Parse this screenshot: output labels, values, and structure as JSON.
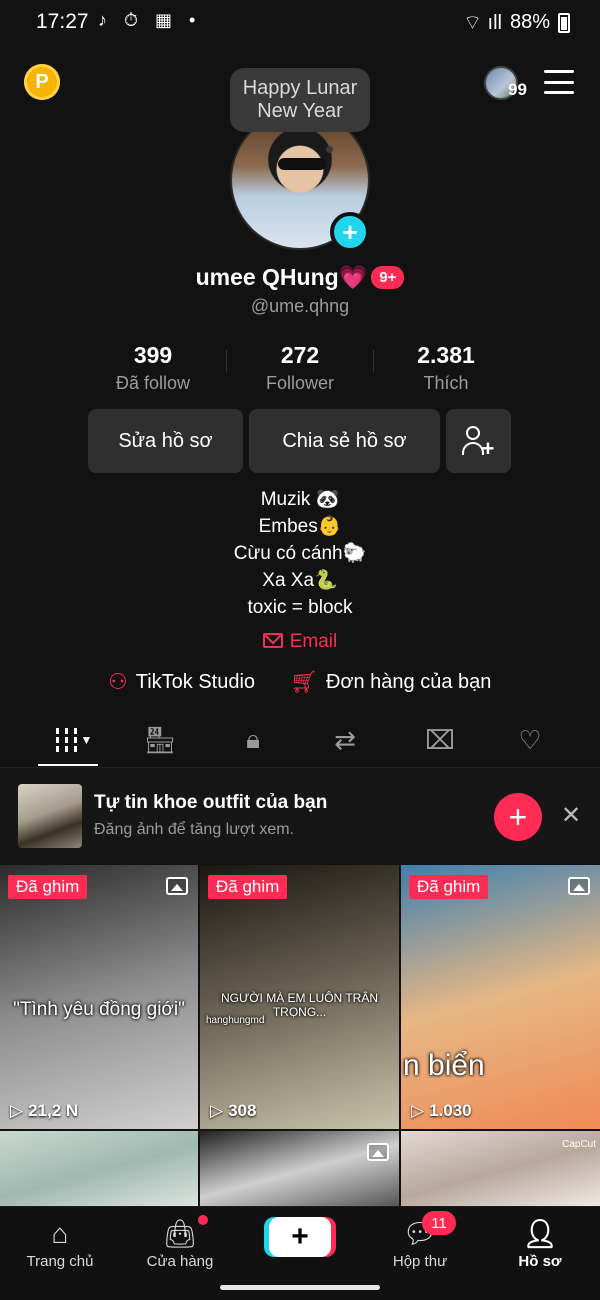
{
  "status_bar": {
    "time": "17:27",
    "left_icons": "♪ ⏱ ▦ •",
    "signal": "⌔ ıll",
    "battery": "88%"
  },
  "header": {
    "story_count": "99"
  },
  "profile": {
    "note": "Happy Lunar New Year",
    "display_name": "umee QHung",
    "display_name_emoji": "💗",
    "badge": "9+",
    "username": "@ume.qhng",
    "stats": [
      {
        "value": "399",
        "label": "Đã follow"
      },
      {
        "value": "272",
        "label": "Follower"
      },
      {
        "value": "2.381",
        "label": "Thích"
      }
    ],
    "buttons": {
      "edit": "Sửa hồ sơ",
      "share": "Chia sẻ hồ sơ"
    },
    "bio": [
      "Muzik 🐼",
      "Embes👶",
      "Cừu có cánh🐑",
      "Xa Xa🐍",
      "toxic = block"
    ],
    "email_label": "Email",
    "links": {
      "studio": "TikTok Studio",
      "orders": "Đơn hàng của bạn"
    }
  },
  "tabs": [
    "videos",
    "shop",
    "private",
    "reposts",
    "favorites-hidden",
    "liked"
  ],
  "promo": {
    "title": "Tự tin khoe outfit của bạn",
    "subtitle": "Đăng ảnh để tăng lượt xem."
  },
  "videos": [
    {
      "pinned": "Đã ghim",
      "views": "21,2 N",
      "overlay": "\"Tình yêu đồng giới\"",
      "colors": [
        "#2b2b2b",
        "#8d8d8d",
        "#d0d0d0"
      ]
    },
    {
      "pinned": "Đã ghim",
      "views": "308",
      "overlay": "NGƯỜI MÀ EM LUÔN TRÂN TRỌNG...",
      "watermark": "hanghungmd",
      "colors": [
        "#1a1712",
        "#6e6656",
        "#c9c2aa"
      ]
    },
    {
      "pinned": "Đã ghim",
      "views": "1.030",
      "overlay": "n biển",
      "colors": [
        "#3f7fb0",
        "#e6b784",
        "#f08a55"
      ]
    },
    {
      "colors": [
        "#c8d8cf",
        "#9fb8b0",
        "#dfe7e2"
      ]
    },
    {
      "colors": [
        "#222222",
        "#cfcfcf",
        "#4d4d4d"
      ]
    },
    {
      "watermark": "CapCut",
      "colors": [
        "#e2d9d2",
        "#b8a79b",
        "#f3eeea"
      ]
    }
  ],
  "bottom_nav": {
    "home": "Trang chủ",
    "shop": "Cửa hàng",
    "inbox": "Hộp thư",
    "inbox_badge": "11",
    "profile": "Hồ sơ"
  },
  "colors": {
    "accent": "#fe2c55",
    "cyan": "#20d5ec",
    "background": "#121212"
  }
}
